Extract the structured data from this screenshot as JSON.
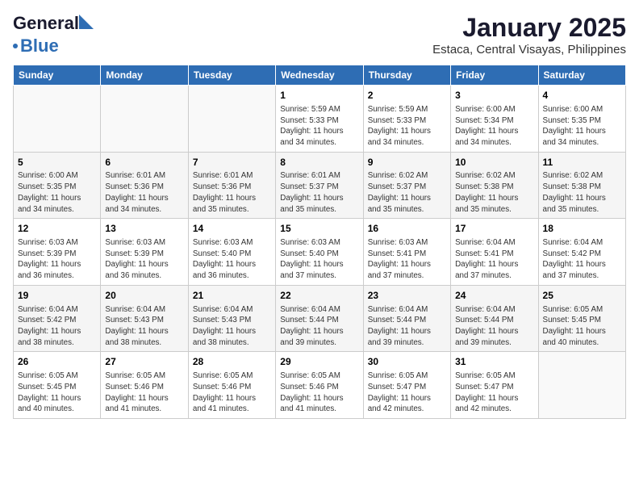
{
  "logo": {
    "line1": "General",
    "line2": "Blue"
  },
  "title": "January 2025",
  "subtitle": "Estaca, Central Visayas, Philippines",
  "days_of_week": [
    "Sunday",
    "Monday",
    "Tuesday",
    "Wednesday",
    "Thursday",
    "Friday",
    "Saturday"
  ],
  "weeks": [
    [
      {
        "num": "",
        "info": ""
      },
      {
        "num": "",
        "info": ""
      },
      {
        "num": "",
        "info": ""
      },
      {
        "num": "1",
        "info": "Sunrise: 5:59 AM\nSunset: 5:33 PM\nDaylight: 11 hours\nand 34 minutes."
      },
      {
        "num": "2",
        "info": "Sunrise: 5:59 AM\nSunset: 5:33 PM\nDaylight: 11 hours\nand 34 minutes."
      },
      {
        "num": "3",
        "info": "Sunrise: 6:00 AM\nSunset: 5:34 PM\nDaylight: 11 hours\nand 34 minutes."
      },
      {
        "num": "4",
        "info": "Sunrise: 6:00 AM\nSunset: 5:35 PM\nDaylight: 11 hours\nand 34 minutes."
      }
    ],
    [
      {
        "num": "5",
        "info": "Sunrise: 6:00 AM\nSunset: 5:35 PM\nDaylight: 11 hours\nand 34 minutes."
      },
      {
        "num": "6",
        "info": "Sunrise: 6:01 AM\nSunset: 5:36 PM\nDaylight: 11 hours\nand 34 minutes."
      },
      {
        "num": "7",
        "info": "Sunrise: 6:01 AM\nSunset: 5:36 PM\nDaylight: 11 hours\nand 35 minutes."
      },
      {
        "num": "8",
        "info": "Sunrise: 6:01 AM\nSunset: 5:37 PM\nDaylight: 11 hours\nand 35 minutes."
      },
      {
        "num": "9",
        "info": "Sunrise: 6:02 AM\nSunset: 5:37 PM\nDaylight: 11 hours\nand 35 minutes."
      },
      {
        "num": "10",
        "info": "Sunrise: 6:02 AM\nSunset: 5:38 PM\nDaylight: 11 hours\nand 35 minutes."
      },
      {
        "num": "11",
        "info": "Sunrise: 6:02 AM\nSunset: 5:38 PM\nDaylight: 11 hours\nand 35 minutes."
      }
    ],
    [
      {
        "num": "12",
        "info": "Sunrise: 6:03 AM\nSunset: 5:39 PM\nDaylight: 11 hours\nand 36 minutes."
      },
      {
        "num": "13",
        "info": "Sunrise: 6:03 AM\nSunset: 5:39 PM\nDaylight: 11 hours\nand 36 minutes."
      },
      {
        "num": "14",
        "info": "Sunrise: 6:03 AM\nSunset: 5:40 PM\nDaylight: 11 hours\nand 36 minutes."
      },
      {
        "num": "15",
        "info": "Sunrise: 6:03 AM\nSunset: 5:40 PM\nDaylight: 11 hours\nand 37 minutes."
      },
      {
        "num": "16",
        "info": "Sunrise: 6:03 AM\nSunset: 5:41 PM\nDaylight: 11 hours\nand 37 minutes."
      },
      {
        "num": "17",
        "info": "Sunrise: 6:04 AM\nSunset: 5:41 PM\nDaylight: 11 hours\nand 37 minutes."
      },
      {
        "num": "18",
        "info": "Sunrise: 6:04 AM\nSunset: 5:42 PM\nDaylight: 11 hours\nand 37 minutes."
      }
    ],
    [
      {
        "num": "19",
        "info": "Sunrise: 6:04 AM\nSunset: 5:42 PM\nDaylight: 11 hours\nand 38 minutes."
      },
      {
        "num": "20",
        "info": "Sunrise: 6:04 AM\nSunset: 5:43 PM\nDaylight: 11 hours\nand 38 minutes."
      },
      {
        "num": "21",
        "info": "Sunrise: 6:04 AM\nSunset: 5:43 PM\nDaylight: 11 hours\nand 38 minutes."
      },
      {
        "num": "22",
        "info": "Sunrise: 6:04 AM\nSunset: 5:44 PM\nDaylight: 11 hours\nand 39 minutes."
      },
      {
        "num": "23",
        "info": "Sunrise: 6:04 AM\nSunset: 5:44 PM\nDaylight: 11 hours\nand 39 minutes."
      },
      {
        "num": "24",
        "info": "Sunrise: 6:04 AM\nSunset: 5:44 PM\nDaylight: 11 hours\nand 39 minutes."
      },
      {
        "num": "25",
        "info": "Sunrise: 6:05 AM\nSunset: 5:45 PM\nDaylight: 11 hours\nand 40 minutes."
      }
    ],
    [
      {
        "num": "26",
        "info": "Sunrise: 6:05 AM\nSunset: 5:45 PM\nDaylight: 11 hours\nand 40 minutes."
      },
      {
        "num": "27",
        "info": "Sunrise: 6:05 AM\nSunset: 5:46 PM\nDaylight: 11 hours\nand 41 minutes."
      },
      {
        "num": "28",
        "info": "Sunrise: 6:05 AM\nSunset: 5:46 PM\nDaylight: 11 hours\nand 41 minutes."
      },
      {
        "num": "29",
        "info": "Sunrise: 6:05 AM\nSunset: 5:46 PM\nDaylight: 11 hours\nand 41 minutes."
      },
      {
        "num": "30",
        "info": "Sunrise: 6:05 AM\nSunset: 5:47 PM\nDaylight: 11 hours\nand 42 minutes."
      },
      {
        "num": "31",
        "info": "Sunrise: 6:05 AM\nSunset: 5:47 PM\nDaylight: 11 hours\nand 42 minutes."
      },
      {
        "num": "",
        "info": ""
      }
    ]
  ]
}
